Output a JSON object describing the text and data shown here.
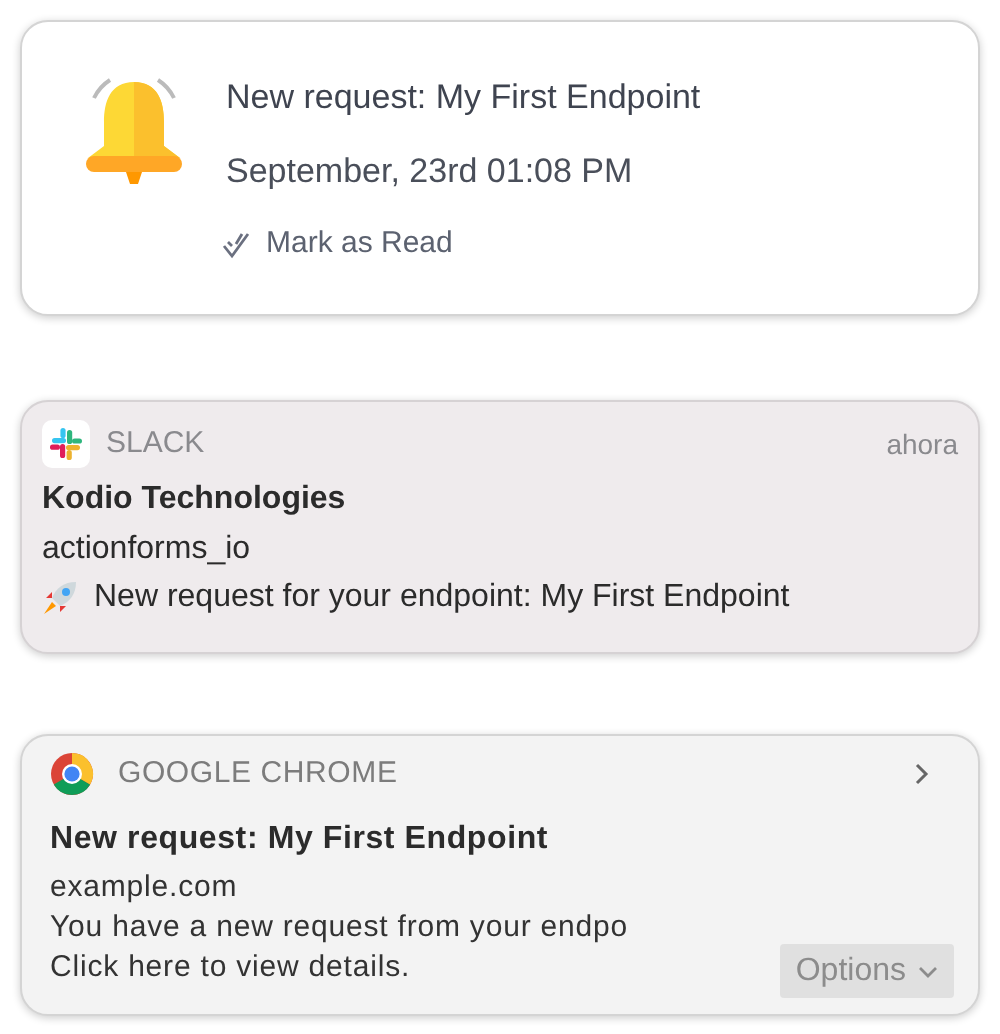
{
  "app_notification": {
    "title": "New request: My First Endpoint",
    "time": "September, 23rd 01:08 PM",
    "action": "Mark as Read"
  },
  "slack_notification": {
    "app": "SLACK",
    "time": "ahora",
    "title": "Kodio Technologies",
    "subtitle": "actionforms_io",
    "message": "New request for your endpoint: My First Endpoint"
  },
  "chrome_notification": {
    "app": "GOOGLE CHROME",
    "title": "New request: My First Endpoint",
    "site": "example.com",
    "message_lines": [
      "You have a new request from your endpo",
      "Click here to view details."
    ],
    "button": "Options"
  }
}
